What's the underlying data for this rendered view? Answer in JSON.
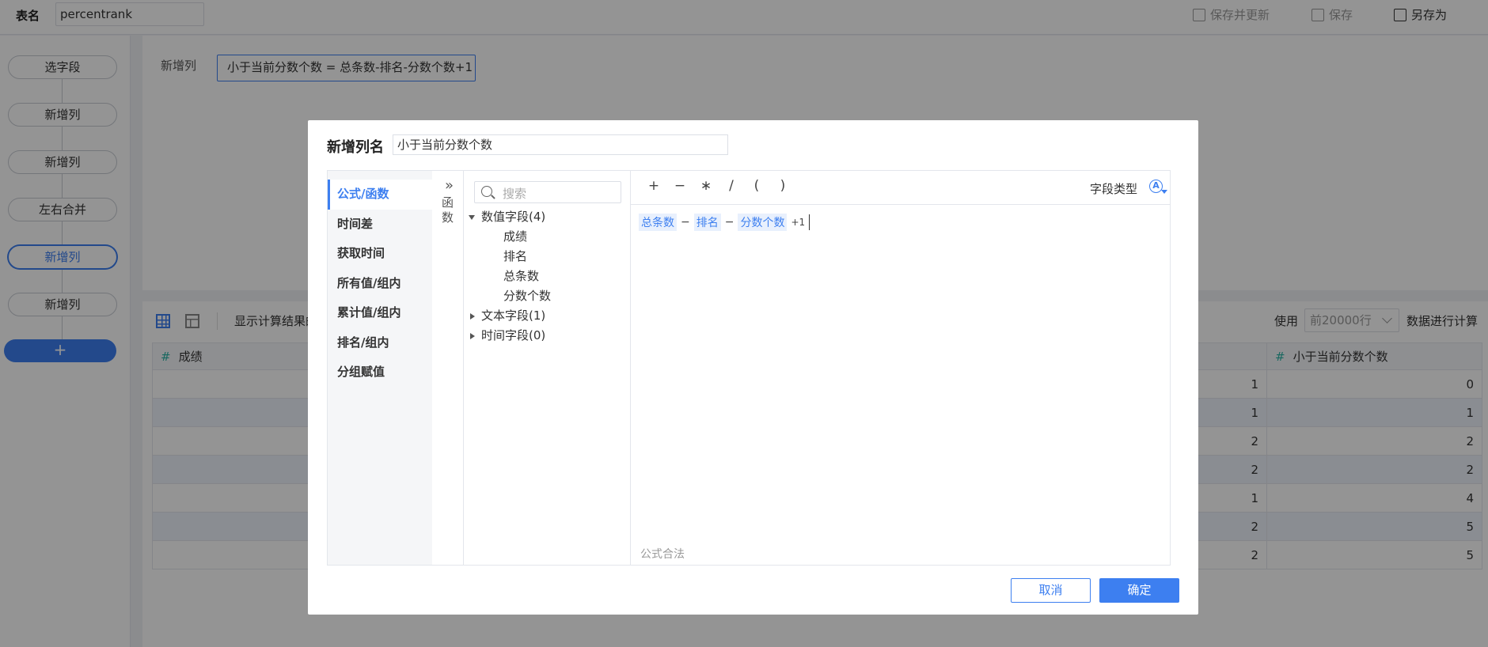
{
  "header": {
    "table_name_label": "表名",
    "table_name_value": "percentrank",
    "save_update_label": "保存并更新",
    "save_label": "保存",
    "save_as_label": "另存为"
  },
  "steps": [
    "选字段",
    "新增列",
    "新增列",
    "左右合并",
    "新增列",
    "新增列"
  ],
  "active_step_index": 4,
  "add_step_icon": "+",
  "main": {
    "new_col_label": "新增列",
    "formula_summary": "小于当前分数个数 = 总条数-排名-分数个数+1"
  },
  "data_toolbar": {
    "show_result_label": "显示计算结果的",
    "use_label": "使用",
    "rows_option": "前20000行",
    "calc_label": "数据进行计算"
  },
  "table": {
    "columns": [
      "成绩",
      "小于当前分数个数"
    ],
    "col_type_icon": "#",
    "rows": [
      {
        "mid": "1",
        "last": "0"
      },
      {
        "mid": "1",
        "last": "1"
      },
      {
        "mid": "2",
        "last": "2"
      },
      {
        "mid": "2",
        "last": "2"
      },
      {
        "mid": "1",
        "last": "4"
      },
      {
        "mid": "2",
        "last": "5"
      },
      {
        "mid": "2",
        "last": "5"
      }
    ]
  },
  "dialog": {
    "title": "新增列名",
    "name_value": "小于当前分数个数",
    "categories": [
      "公式/函数",
      "时间差",
      "获取时间",
      "所有值/组内",
      "累计值/组内",
      "排名/组内",
      "分组赋值"
    ],
    "fn_toggle_icon": "»",
    "fn_label_1": "函",
    "fn_label_2": "数",
    "search_placeholder": "搜索",
    "groups": {
      "numeric": "数值字段(4)",
      "numeric_fields": [
        "成绩",
        "排名",
        "总条数",
        "分数个数"
      ],
      "text": "文本字段(1)",
      "time": "时间字段(0)"
    },
    "operators": [
      "+",
      "−",
      "∗",
      "/",
      "(",
      ")"
    ],
    "field_type_label": "字段类型",
    "field_type_icon": "A",
    "formula": {
      "f1": "总条数",
      "op1": "−",
      "f2": "排名",
      "op2": "−",
      "f3": "分数个数",
      "tail": "+1"
    },
    "valid_msg": "公式合法",
    "cancel_label": "取消",
    "ok_label": "确定"
  },
  "colors": {
    "accent": "#3d7ff0",
    "field_type_hash": "#2bb3a6"
  }
}
